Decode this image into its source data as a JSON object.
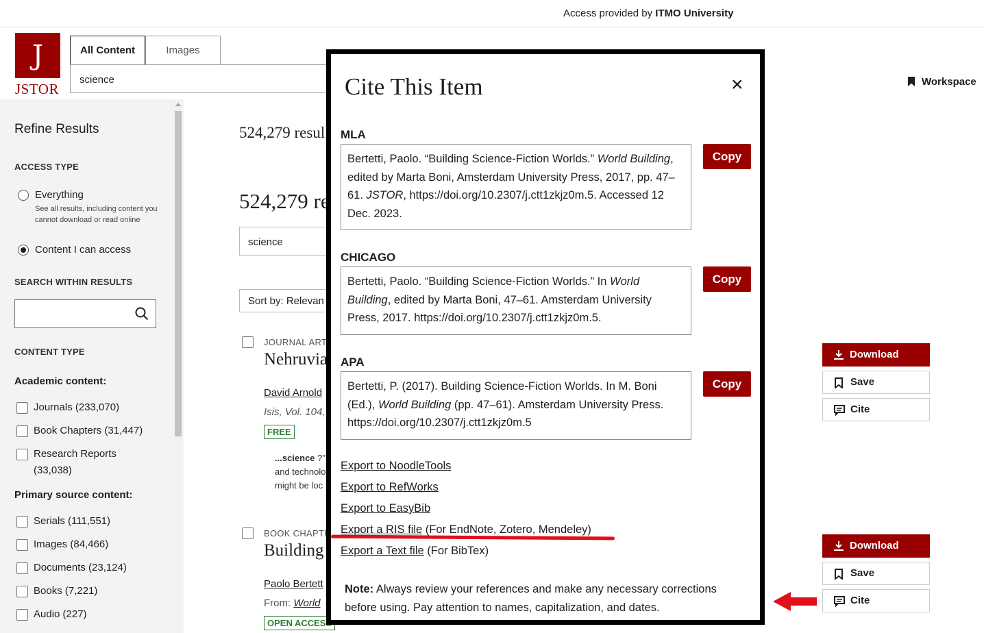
{
  "topbar": {
    "access_prefix": "Access provided by ",
    "access_org": "ITMO University"
  },
  "logo": {
    "word": "JSTOR",
    "glyph": "J"
  },
  "header": {
    "tabs": [
      "All Content",
      "Images"
    ],
    "search_value": "science",
    "workspace_label": "Workspace"
  },
  "sidebar": {
    "title": "Refine Results",
    "access_type_heading": "ACCESS TYPE",
    "access_options": [
      {
        "label": "Everything",
        "desc": "See all results, including content you cannot download or read online",
        "selected": false
      },
      {
        "label": "Content I can access",
        "selected": true
      }
    ],
    "search_within_heading": "SEARCH WITHIN RESULTS",
    "content_type_heading": "CONTENT TYPE",
    "academic_heading": "Academic content:",
    "academic_items": [
      "Journals (233,070)",
      "Book Chapters (31,447)",
      "Research Reports",
      "(33,038)"
    ],
    "primary_heading": "Primary source content:",
    "primary_items": [
      "Serials (111,551)",
      "Images (84,466)",
      "Documents (23,124)",
      "Books (7,221)",
      "Audio (227)"
    ]
  },
  "main": {
    "result_count_top": "524,279 resul",
    "result_count_big": "524,279 re",
    "search_value": "science",
    "sort_label": "Sort by: Relevan",
    "results": [
      {
        "type": "JOURNAL ART",
        "title": "Nehruvia",
        "author": "David Arnold",
        "source": "Isis, Vol. 104,",
        "badge": "FREE",
        "snippet_bold": "...science",
        "snippet_rest": " ?\"",
        "snippet_lines": [
          "and technolo",
          "might be loc"
        ]
      },
      {
        "type": "BOOK CHAPTE",
        "title": "Building S",
        "author": "Paolo Bertett",
        "source_prefix": "From: ",
        "source_link": "World",
        "badge": "OPEN ACCESS"
      }
    ],
    "buttons": {
      "download": "Download",
      "save": "Save",
      "cite": "Cite"
    }
  },
  "modal": {
    "title": "Cite This Item",
    "close_label": "×",
    "copy_label": "Copy",
    "mla": {
      "label": "MLA",
      "parts": [
        {
          "t": "Bertetti, Paolo. “Building Science-Fiction Worlds.” ",
          "i": false
        },
        {
          "t": "World Building",
          "i": true
        },
        {
          "t": ", edited by Marta Boni, Amsterdam University Press, 2017, pp. 47–61. ",
          "i": false
        },
        {
          "t": "JSTOR",
          "i": true
        },
        {
          "t": ", https://doi.org/10.2307/j.ctt1zkjz0m.5. Accessed 12 Dec. 2023.",
          "i": false
        }
      ]
    },
    "chicago": {
      "label": "CHICAGO",
      "parts": [
        {
          "t": "Bertetti, Paolo. “Building Science-Fiction Worlds.” In ",
          "i": false
        },
        {
          "t": "World Building",
          "i": true
        },
        {
          "t": ", edited by Marta Boni, 47–61. Amsterdam University Press, 2017. https://doi.org/10.2307/j.ctt1zkjz0m.5.",
          "i": false
        }
      ]
    },
    "apa": {
      "label": "APA",
      "parts": [
        {
          "t": "Bertetti, P. (2017). Building Science-Fiction Worlds. In M. Boni (Ed.), ",
          "i": false
        },
        {
          "t": "World Building",
          "i": true
        },
        {
          "t": " (pp. 47–61). Amsterdam University Press. https://doi.org/10.2307/j.ctt1zkjz0m.5",
          "i": false
        }
      ]
    },
    "exports": [
      {
        "link": "Export to NoodleTools",
        "rest": ""
      },
      {
        "link": "Export to RefWorks",
        "rest": ""
      },
      {
        "link": "Export to EasyBib",
        "rest": ""
      },
      {
        "link": "Export a RIS file",
        "rest": " (For EndNote, Zotero, Mendeley)"
      },
      {
        "link": "Export a Text file",
        "rest": " (For BibTex)"
      }
    ],
    "note_bold": "Note:",
    "note_text": " Always review your references and make any necessary corrections before using. Pay attention to names, capitalization, and dates."
  },
  "colors": {
    "brand": "#990000",
    "annotation": "#e0101a",
    "open_access": "#2e7d32"
  },
  "icons": [
    "bookmark-icon",
    "search-icon",
    "download-icon",
    "cite-icon",
    "close-icon",
    "arrow-left-icon"
  ]
}
